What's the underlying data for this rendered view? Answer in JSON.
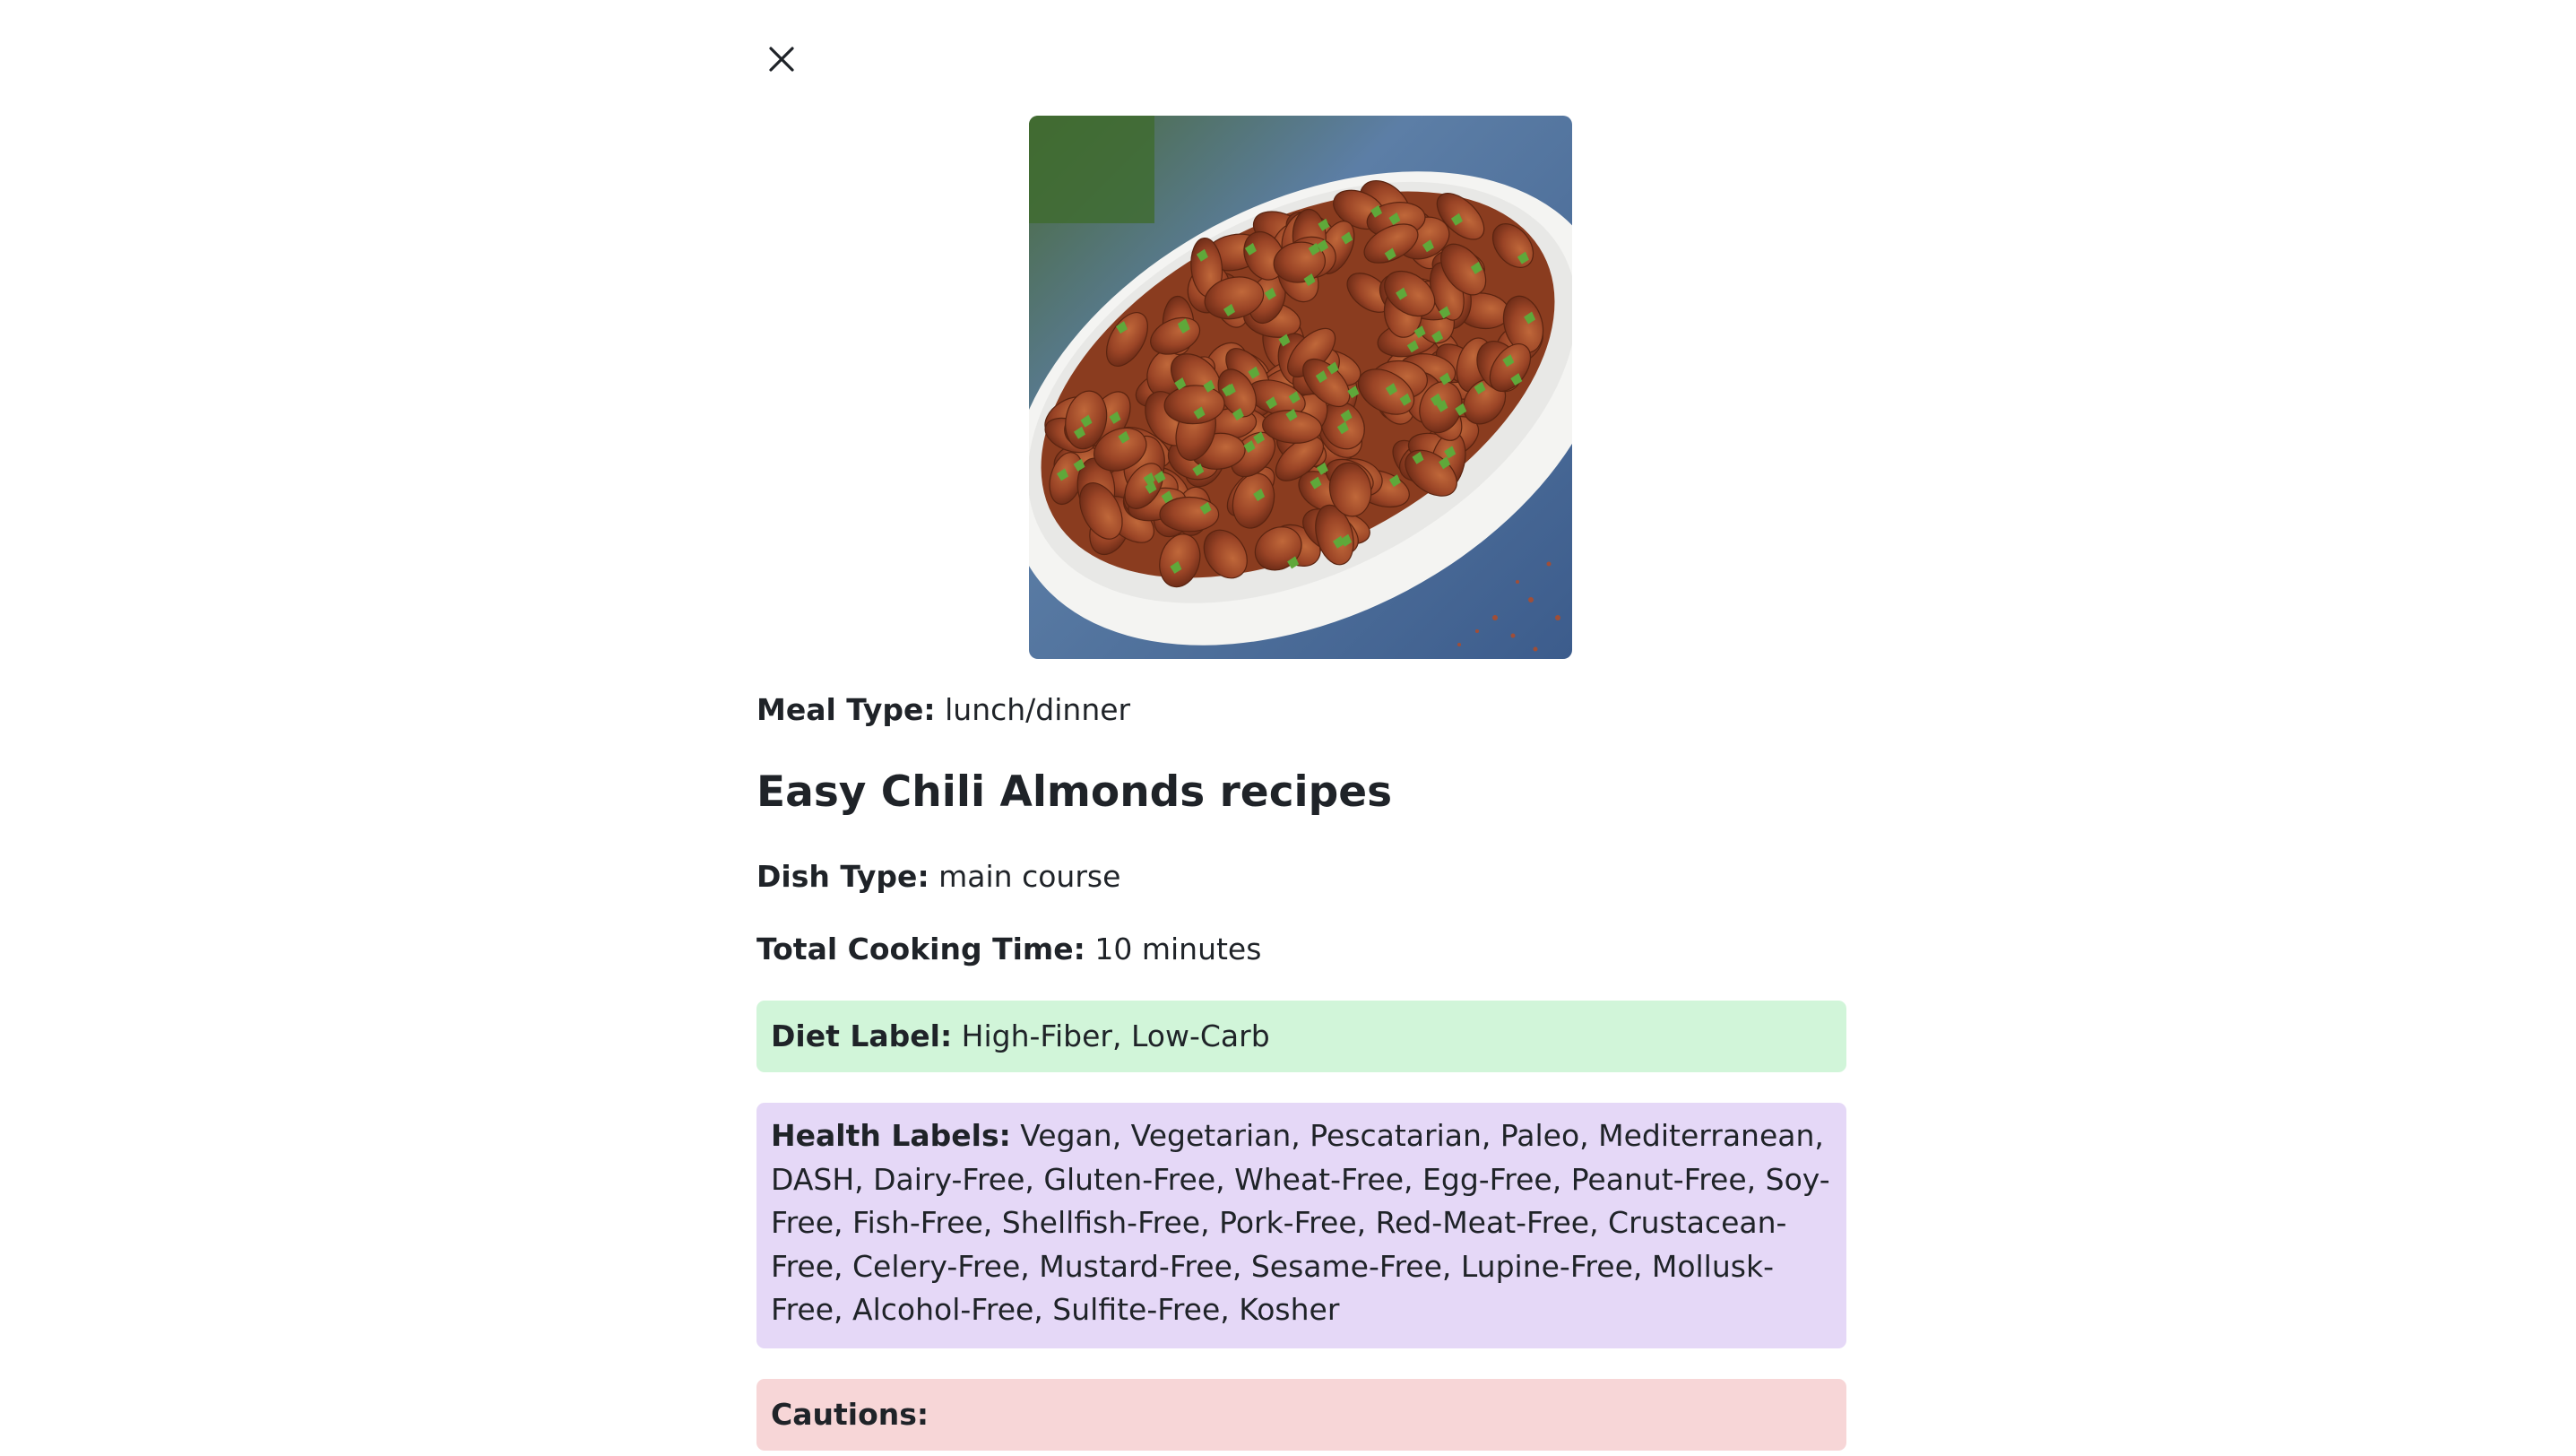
{
  "close": {
    "icon": "close-icon"
  },
  "recipe": {
    "image_alt": "Chili almonds in a white oval dish",
    "meal_type_label": "Meal Type:",
    "meal_type_value": "lunch/dinner",
    "title": "Easy Chili Almonds recipes",
    "dish_type_label": "Dish Type:",
    "dish_type_value": "main course",
    "cooking_time_label": "Total Cooking Time:",
    "cooking_time_value": "10 minutes",
    "diet_label": "Diet Label:",
    "diet_value": "High-Fiber, Low-Carb",
    "health_label": "Health Labels:",
    "health_value": "Vegan, Vegetarian, Pescatarian, Paleo, Mediterranean, DASH, Dairy-Free, Gluten-Free, Wheat-Free, Egg-Free, Peanut-Free, Soy-Free, Fish-Free, Shellfish-Free, Pork-Free, Red-Meat-Free, Crustacean-Free, Celery-Free, Mustard-Free, Sesame-Free, Lupine-Free, Mollusk-Free, Alcohol-Free, Sulfite-Free, Kosher",
    "cautions_label": "Cautions:",
    "cautions_value": ""
  },
  "colors": {
    "diet_bg": "#d1f5d9",
    "health_bg": "#e5d8f7",
    "cautions_bg": "#f7d6d7"
  }
}
